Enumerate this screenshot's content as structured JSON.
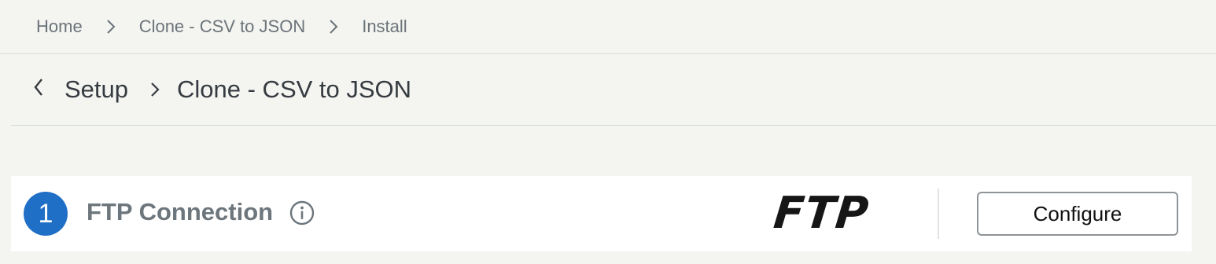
{
  "breadcrumb": {
    "items": [
      "Home",
      "Clone - CSV to JSON",
      "Install"
    ]
  },
  "subheader": {
    "back_label": "Setup",
    "title": "Clone - CSV to JSON"
  },
  "step": {
    "number": "1",
    "title": "FTP Connection",
    "logo_text": "FTP",
    "configure_label": "Configure"
  },
  "icons": {
    "chevron": "chevron-right-icon",
    "back": "chevron-left-icon",
    "info": "info-icon"
  },
  "colors": {
    "accent": "#1f6fc7",
    "background": "#f4f4f1"
  }
}
